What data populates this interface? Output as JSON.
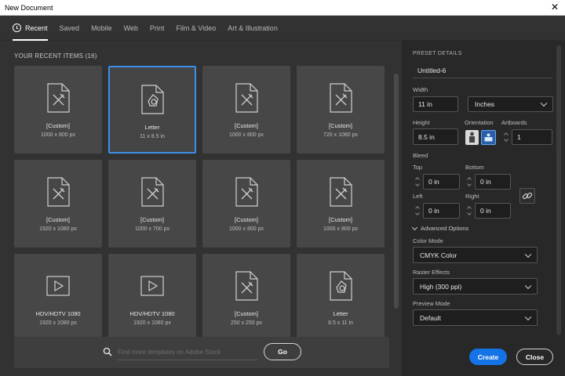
{
  "window": {
    "title": "New Document"
  },
  "tabs": [
    {
      "label": "Recent",
      "active": true
    },
    {
      "label": "Saved"
    },
    {
      "label": "Mobile"
    },
    {
      "label": "Web"
    },
    {
      "label": "Print"
    },
    {
      "label": "Film & Video"
    },
    {
      "label": "Art & Illustration"
    }
  ],
  "recent": {
    "heading": "YOUR RECENT ITEMS",
    "count": "(16)",
    "items": [
      {
        "name": "[Custom]",
        "size": "1000 x 800 px",
        "icon": "custom-doc-icon"
      },
      {
        "name": "Letter",
        "size": "11 x 8.5 in",
        "icon": "letter-doc-icon",
        "selected": true
      },
      {
        "name": "[Custom]",
        "size": "1000 x 800 px",
        "icon": "custom-doc-icon"
      },
      {
        "name": "[Custom]",
        "size": "720 x 1080 px",
        "icon": "custom-doc-icon"
      },
      {
        "name": "[Custom]",
        "size": "1920 x 1080 px",
        "icon": "custom-doc-icon"
      },
      {
        "name": "[Custom]",
        "size": "1000 x 700 px",
        "icon": "custom-doc-icon"
      },
      {
        "name": "[Custom]",
        "size": "1000 x 800 px",
        "icon": "custom-doc-icon"
      },
      {
        "name": "[Custom]",
        "size": "1000 x 800 px",
        "icon": "custom-doc-icon"
      },
      {
        "name": "HDV/HDTV 1080",
        "size": "1920 x 1080 px",
        "icon": "video-play-icon"
      },
      {
        "name": "HDV/HDTV 1080",
        "size": "1920 x 1080 px",
        "icon": "video-play-icon"
      },
      {
        "name": "[Custom]",
        "size": "250 x 250 px",
        "icon": "custom-doc-icon"
      },
      {
        "name": "Letter",
        "size": "8.5 x 11 in",
        "icon": "letter-doc-icon"
      }
    ]
  },
  "search": {
    "placeholder": "Find more templates on Adobe Stock",
    "value": "",
    "go_label": "Go"
  },
  "preset": {
    "heading": "PRESET DETAILS",
    "name": "Untitled-6",
    "width_label": "Width",
    "width": "11 in",
    "units": "Inches",
    "height_label": "Height",
    "height": "8.5 in",
    "orientation_label": "Orientation",
    "artboards_label": "Artboards",
    "artboards": "1",
    "bleed_label": "Bleed",
    "top_label": "Top",
    "top": "0 in",
    "bottom_label": "Bottom",
    "bottom": "0 in",
    "left_label": "Left",
    "left": "0 in",
    "right_label": "Right",
    "right": "0 in",
    "advanced_label": "Advanced Options",
    "color_mode_label": "Color Mode",
    "color_mode": "CMYK Color",
    "raster_label": "Raster Effects",
    "raster": "High (300 ppi)",
    "preview_label": "Preview Mode",
    "preview": "Default"
  },
  "actions": {
    "create": "Create",
    "close": "Close"
  },
  "colors": {
    "accent": "#1473e6",
    "selection": "#3b8eea",
    "panel": "#323232",
    "side_panel": "#282828",
    "card": "#474747"
  }
}
